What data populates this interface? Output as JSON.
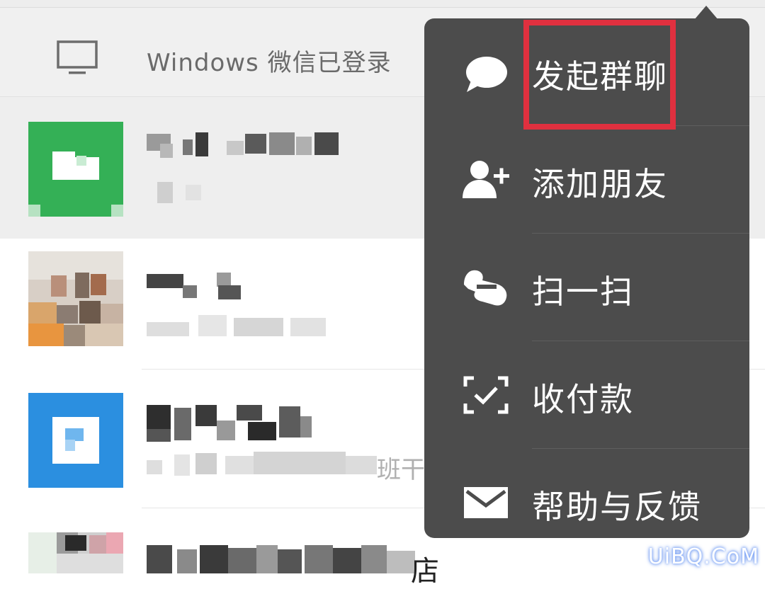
{
  "login_bar": {
    "text": "Windows 微信已登录",
    "icon": "monitor-icon"
  },
  "chats": [
    {
      "avatar_color": "#34b056",
      "snippet_fragment": ""
    },
    {
      "avatar_color": "#d8cfc6",
      "snippet_fragment": ""
    },
    {
      "avatar_color": "#2b8fe0",
      "snippet_fragment": "班干"
    },
    {
      "avatar_color": "#cfcfcf",
      "title_fragment": "店"
    }
  ],
  "menu": {
    "items": [
      {
        "label": "发起群聊",
        "icon": "chat-bubble-icon",
        "highlighted": true
      },
      {
        "label": "添加朋友",
        "icon": "add-friend-icon"
      },
      {
        "label": "扫一扫",
        "icon": "scan-icon"
      },
      {
        "label": "收付款",
        "icon": "payment-icon"
      },
      {
        "label": "帮助与反馈",
        "icon": "mail-icon"
      }
    ],
    "highlight_color": "#e0303f",
    "background": "#4c4c4c"
  },
  "watermark": "UiBQ.CoM"
}
